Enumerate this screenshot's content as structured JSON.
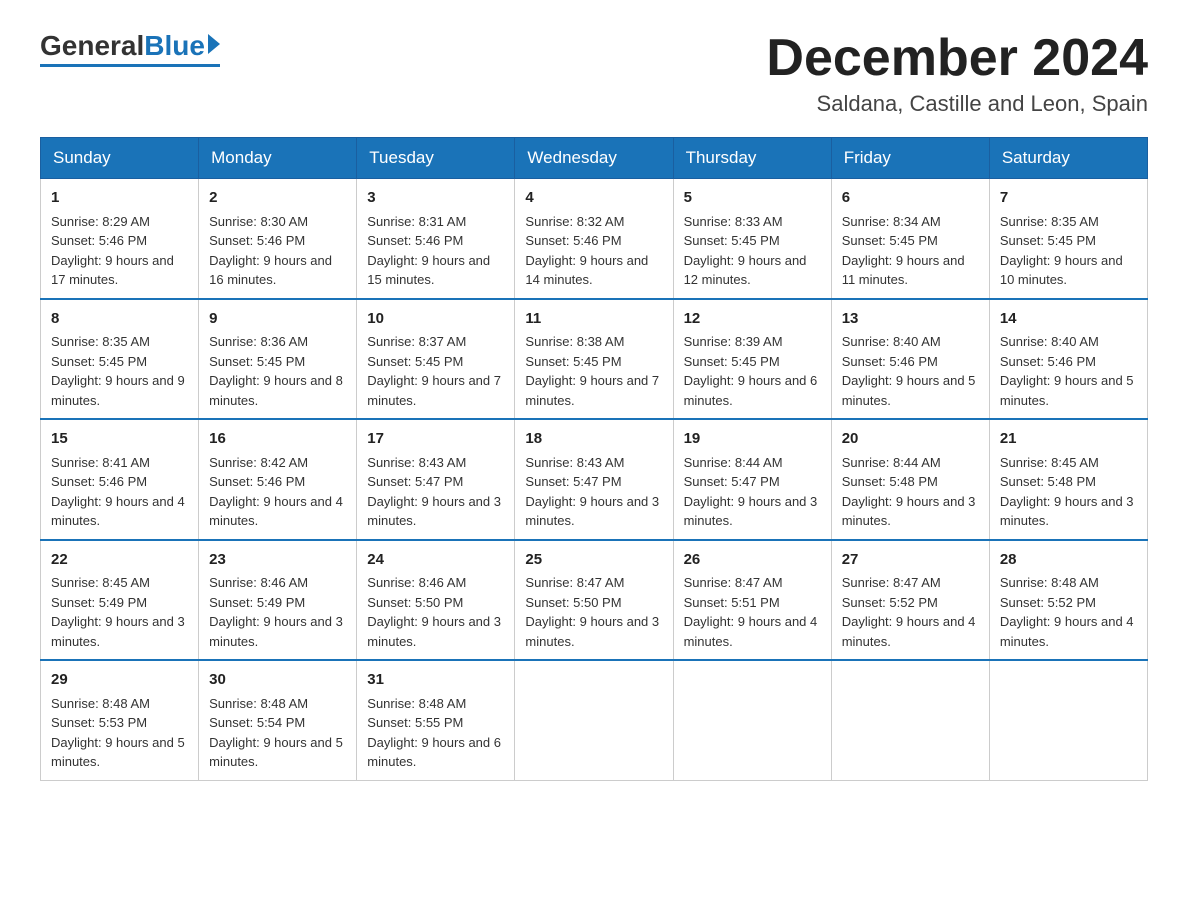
{
  "logo": {
    "general": "General",
    "blue": "Blue"
  },
  "title": {
    "month_year": "December 2024",
    "location": "Saldana, Castille and Leon, Spain"
  },
  "days_of_week": [
    "Sunday",
    "Monday",
    "Tuesday",
    "Wednesday",
    "Thursday",
    "Friday",
    "Saturday"
  ],
  "weeks": [
    [
      {
        "day": "1",
        "sunrise": "Sunrise: 8:29 AM",
        "sunset": "Sunset: 5:46 PM",
        "daylight": "Daylight: 9 hours and 17 minutes."
      },
      {
        "day": "2",
        "sunrise": "Sunrise: 8:30 AM",
        "sunset": "Sunset: 5:46 PM",
        "daylight": "Daylight: 9 hours and 16 minutes."
      },
      {
        "day": "3",
        "sunrise": "Sunrise: 8:31 AM",
        "sunset": "Sunset: 5:46 PM",
        "daylight": "Daylight: 9 hours and 15 minutes."
      },
      {
        "day": "4",
        "sunrise": "Sunrise: 8:32 AM",
        "sunset": "Sunset: 5:46 PM",
        "daylight": "Daylight: 9 hours and 14 minutes."
      },
      {
        "day": "5",
        "sunrise": "Sunrise: 8:33 AM",
        "sunset": "Sunset: 5:45 PM",
        "daylight": "Daylight: 9 hours and 12 minutes."
      },
      {
        "day": "6",
        "sunrise": "Sunrise: 8:34 AM",
        "sunset": "Sunset: 5:45 PM",
        "daylight": "Daylight: 9 hours and 11 minutes."
      },
      {
        "day": "7",
        "sunrise": "Sunrise: 8:35 AM",
        "sunset": "Sunset: 5:45 PM",
        "daylight": "Daylight: 9 hours and 10 minutes."
      }
    ],
    [
      {
        "day": "8",
        "sunrise": "Sunrise: 8:35 AM",
        "sunset": "Sunset: 5:45 PM",
        "daylight": "Daylight: 9 hours and 9 minutes."
      },
      {
        "day": "9",
        "sunrise": "Sunrise: 8:36 AM",
        "sunset": "Sunset: 5:45 PM",
        "daylight": "Daylight: 9 hours and 8 minutes."
      },
      {
        "day": "10",
        "sunrise": "Sunrise: 8:37 AM",
        "sunset": "Sunset: 5:45 PM",
        "daylight": "Daylight: 9 hours and 7 minutes."
      },
      {
        "day": "11",
        "sunrise": "Sunrise: 8:38 AM",
        "sunset": "Sunset: 5:45 PM",
        "daylight": "Daylight: 9 hours and 7 minutes."
      },
      {
        "day": "12",
        "sunrise": "Sunrise: 8:39 AM",
        "sunset": "Sunset: 5:45 PM",
        "daylight": "Daylight: 9 hours and 6 minutes."
      },
      {
        "day": "13",
        "sunrise": "Sunrise: 8:40 AM",
        "sunset": "Sunset: 5:46 PM",
        "daylight": "Daylight: 9 hours and 5 minutes."
      },
      {
        "day": "14",
        "sunrise": "Sunrise: 8:40 AM",
        "sunset": "Sunset: 5:46 PM",
        "daylight": "Daylight: 9 hours and 5 minutes."
      }
    ],
    [
      {
        "day": "15",
        "sunrise": "Sunrise: 8:41 AM",
        "sunset": "Sunset: 5:46 PM",
        "daylight": "Daylight: 9 hours and 4 minutes."
      },
      {
        "day": "16",
        "sunrise": "Sunrise: 8:42 AM",
        "sunset": "Sunset: 5:46 PM",
        "daylight": "Daylight: 9 hours and 4 minutes."
      },
      {
        "day": "17",
        "sunrise": "Sunrise: 8:43 AM",
        "sunset": "Sunset: 5:47 PM",
        "daylight": "Daylight: 9 hours and 3 minutes."
      },
      {
        "day": "18",
        "sunrise": "Sunrise: 8:43 AM",
        "sunset": "Sunset: 5:47 PM",
        "daylight": "Daylight: 9 hours and 3 minutes."
      },
      {
        "day": "19",
        "sunrise": "Sunrise: 8:44 AM",
        "sunset": "Sunset: 5:47 PM",
        "daylight": "Daylight: 9 hours and 3 minutes."
      },
      {
        "day": "20",
        "sunrise": "Sunrise: 8:44 AM",
        "sunset": "Sunset: 5:48 PM",
        "daylight": "Daylight: 9 hours and 3 minutes."
      },
      {
        "day": "21",
        "sunrise": "Sunrise: 8:45 AM",
        "sunset": "Sunset: 5:48 PM",
        "daylight": "Daylight: 9 hours and 3 minutes."
      }
    ],
    [
      {
        "day": "22",
        "sunrise": "Sunrise: 8:45 AM",
        "sunset": "Sunset: 5:49 PM",
        "daylight": "Daylight: 9 hours and 3 minutes."
      },
      {
        "day": "23",
        "sunrise": "Sunrise: 8:46 AM",
        "sunset": "Sunset: 5:49 PM",
        "daylight": "Daylight: 9 hours and 3 minutes."
      },
      {
        "day": "24",
        "sunrise": "Sunrise: 8:46 AM",
        "sunset": "Sunset: 5:50 PM",
        "daylight": "Daylight: 9 hours and 3 minutes."
      },
      {
        "day": "25",
        "sunrise": "Sunrise: 8:47 AM",
        "sunset": "Sunset: 5:50 PM",
        "daylight": "Daylight: 9 hours and 3 minutes."
      },
      {
        "day": "26",
        "sunrise": "Sunrise: 8:47 AM",
        "sunset": "Sunset: 5:51 PM",
        "daylight": "Daylight: 9 hours and 4 minutes."
      },
      {
        "day": "27",
        "sunrise": "Sunrise: 8:47 AM",
        "sunset": "Sunset: 5:52 PM",
        "daylight": "Daylight: 9 hours and 4 minutes."
      },
      {
        "day": "28",
        "sunrise": "Sunrise: 8:48 AM",
        "sunset": "Sunset: 5:52 PM",
        "daylight": "Daylight: 9 hours and 4 minutes."
      }
    ],
    [
      {
        "day": "29",
        "sunrise": "Sunrise: 8:48 AM",
        "sunset": "Sunset: 5:53 PM",
        "daylight": "Daylight: 9 hours and 5 minutes."
      },
      {
        "day": "30",
        "sunrise": "Sunrise: 8:48 AM",
        "sunset": "Sunset: 5:54 PM",
        "daylight": "Daylight: 9 hours and 5 minutes."
      },
      {
        "day": "31",
        "sunrise": "Sunrise: 8:48 AM",
        "sunset": "Sunset: 5:55 PM",
        "daylight": "Daylight: 9 hours and 6 minutes."
      },
      null,
      null,
      null,
      null
    ]
  ]
}
